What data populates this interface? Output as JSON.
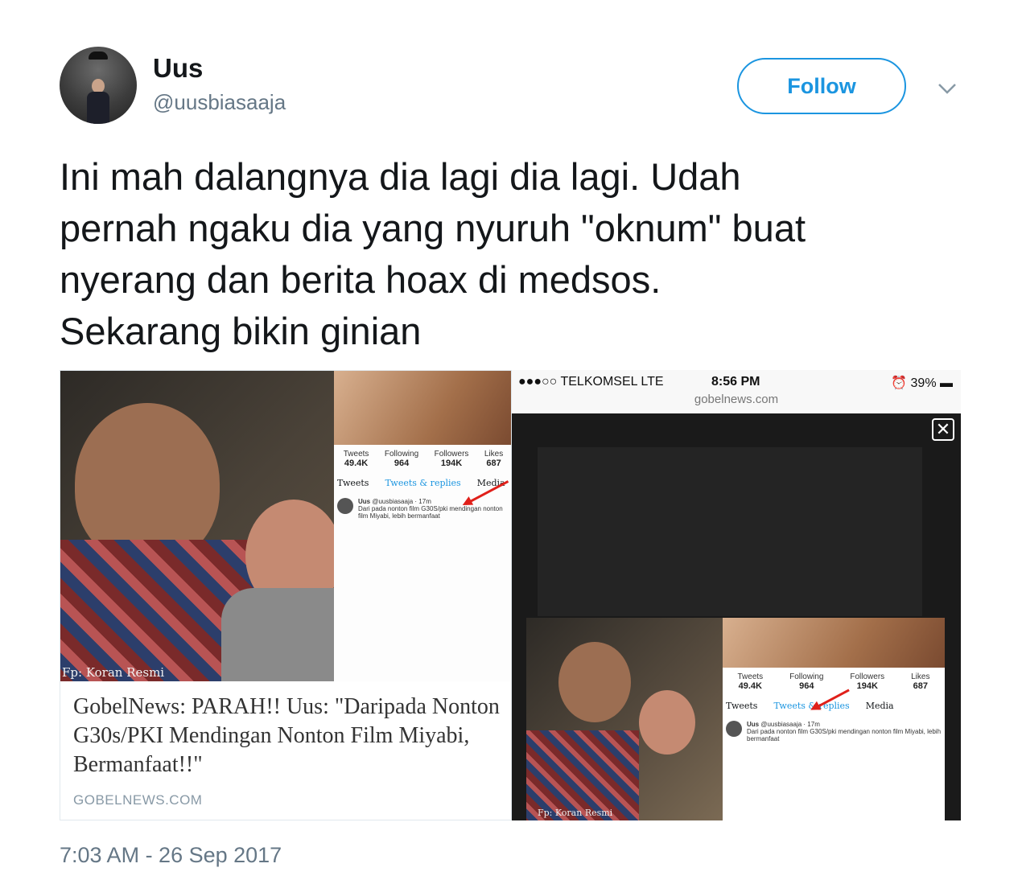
{
  "user": {
    "display_name": "Uus",
    "handle": "@uusbiasaaja"
  },
  "actions": {
    "follow_label": "Follow"
  },
  "tweet": {
    "lines": [
      "Ini mah dalangnya dia lagi dia lagi. Udah",
      "pernah ngaku dia yang nyuruh \"oknum\" buat",
      "nyerang dan berita hoax di medsos.",
      "Sekarang bikin ginian"
    ],
    "timestamp": "7:03 AM - 26 Sep 2017"
  },
  "media_left": {
    "watermark": "Fp: Koran Resmi",
    "stats": [
      {
        "label": "Tweets",
        "value": "49.4K"
      },
      {
        "label": "Following",
        "value": "964"
      },
      {
        "label": "Followers",
        "value": "194K"
      },
      {
        "label": "Likes",
        "value": "687"
      }
    ],
    "tabs": [
      "Tweets",
      "Tweets & replies",
      "Media"
    ],
    "embedded_tweet": {
      "author": "Uus",
      "handle": "@uusbiasaaja · 17m",
      "text": "Dari pada nonton film G30S/pki mendingan nonton film Miyabi, lebih bermanfaat"
    },
    "headline_lines": [
      "GobelNews: PARAH!! Uus: \"Daripada Nonton",
      "G30s/PKI Mendingan Nonton Film Miyabi,",
      "Bermanfaat!!\""
    ],
    "domain": "GOBELNEWS.COM"
  },
  "media_right": {
    "carrier": "●●●○○ TELKOMSEL  LTE",
    "time": "8:56 PM",
    "battery": "⏰ 39% ▬",
    "url": "gobelnews.com",
    "close_symbol": "✕",
    "watermark": "Fp: Koran Resmi"
  },
  "icons": {
    "caret": "chevron-down-icon",
    "close": "close-icon"
  },
  "colors": {
    "accent": "#1b95e0",
    "text": "#14171a",
    "muted": "#657786",
    "arrow": "#e0201a"
  }
}
